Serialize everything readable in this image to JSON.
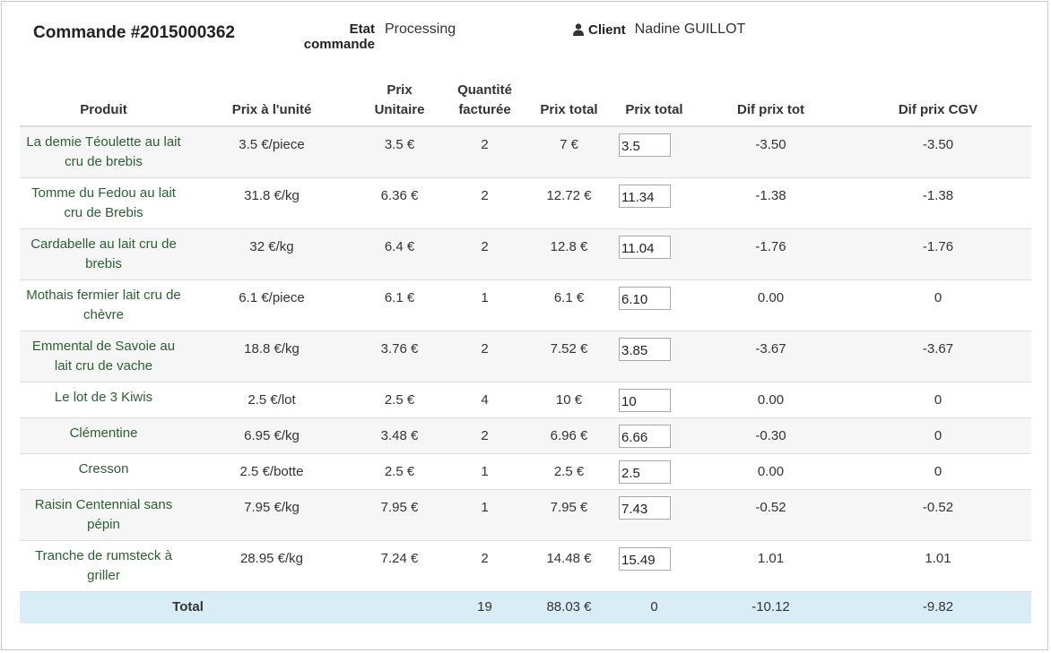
{
  "header": {
    "order_title": "Commande #2015000362",
    "etat_label_1": "Etat",
    "etat_label_2": "commande",
    "etat_value": "Processing",
    "client_label": "Client",
    "client_value": "Nadine GUILLOT",
    "client_icon": "user-icon"
  },
  "table": {
    "columns": {
      "produit": "Produit",
      "prix_unite": "Prix à l'unité",
      "prix_unitaire_1": "Prix",
      "prix_unitaire_2": "Unitaire",
      "quantite_1": "Quantité",
      "quantite_2": "facturée",
      "prix_total": "Prix total",
      "prix_total_input": "Prix total",
      "dif_prix_tot": "Dif prix tot",
      "dif_prix_cgv": "Dif prix CGV"
    },
    "rows": [
      {
        "produit": "La demie Téoulette au lait cru de brebis",
        "prix_unite": "3.5 €/piece",
        "prix_unitaire": "3.5 €",
        "quantite": "2",
        "prix_total": "7 €",
        "input_value": "3.5",
        "dif_tot": "-3.50",
        "dif_cgv": "-3.50"
      },
      {
        "produit": "Tomme du Fedou au lait cru de Brebis",
        "prix_unite": "31.8 €/kg",
        "prix_unitaire": "6.36 €",
        "quantite": "2",
        "prix_total": "12.72 €",
        "input_value": "11.34",
        "dif_tot": "-1.38",
        "dif_cgv": "-1.38"
      },
      {
        "produit": "Cardabelle au lait cru de brebis",
        "prix_unite": "32 €/kg",
        "prix_unitaire": "6.4 €",
        "quantite": "2",
        "prix_total": "12.8 €",
        "input_value": "11.04",
        "dif_tot": "-1.76",
        "dif_cgv": "-1.76"
      },
      {
        "produit": "Mothais fermier lait cru de chèvre",
        "prix_unite": "6.1 €/piece",
        "prix_unitaire": "6.1 €",
        "quantite": "1",
        "prix_total": "6.1 €",
        "input_value": "6.10",
        "dif_tot": "0.00",
        "dif_cgv": "0"
      },
      {
        "produit": "Emmental de Savoie au lait cru de vache",
        "prix_unite": "18.8 €/kg",
        "prix_unitaire": "3.76 €",
        "quantite": "2",
        "prix_total": "7.52 €",
        "input_value": "3.85",
        "dif_tot": "-3.67",
        "dif_cgv": "-3.67"
      },
      {
        "produit": "Le lot de 3 Kiwis",
        "prix_unite": "2.5 €/lot",
        "prix_unitaire": "2.5 €",
        "quantite": "4",
        "prix_total": "10 €",
        "input_value": "10",
        "dif_tot": "0.00",
        "dif_cgv": "0"
      },
      {
        "produit": "Clémentine",
        "prix_unite": "6.95 €/kg",
        "prix_unitaire": "3.48 €",
        "quantite": "2",
        "prix_total": "6.96 €",
        "input_value": "6.66",
        "dif_tot": "-0.30",
        "dif_cgv": "0"
      },
      {
        "produit": "Cresson",
        "prix_unite": "2.5 €/botte",
        "prix_unitaire": "2.5 €",
        "quantite": "1",
        "prix_total": "2.5 €",
        "input_value": "2.5",
        "dif_tot": "0.00",
        "dif_cgv": "0"
      },
      {
        "produit": "Raisin Centennial sans pépin",
        "prix_unite": "7.95 €/kg",
        "prix_unitaire": "7.95 €",
        "quantite": "1",
        "prix_total": "7.95 €",
        "input_value": "7.43",
        "dif_tot": "-0.52",
        "dif_cgv": "-0.52"
      },
      {
        "produit": "Tranche de rumsteck à griller",
        "prix_unite": "28.95 €/kg",
        "prix_unitaire": "7.24 €",
        "quantite": "2",
        "prix_total": "14.48 €",
        "input_value": "15.49",
        "dif_tot": "1.01",
        "dif_cgv": "1.01"
      }
    ],
    "total": {
      "label": "Total",
      "quantite": "19",
      "prix_total": "88.03 €",
      "input_total": "0",
      "dif_tot": "-10.12",
      "dif_cgv": "-9.82"
    }
  },
  "colors": {
    "product_link": "#2a6130",
    "total_row_bg": "#d9edf7",
    "stripe_bg": "#f6f6f6"
  }
}
